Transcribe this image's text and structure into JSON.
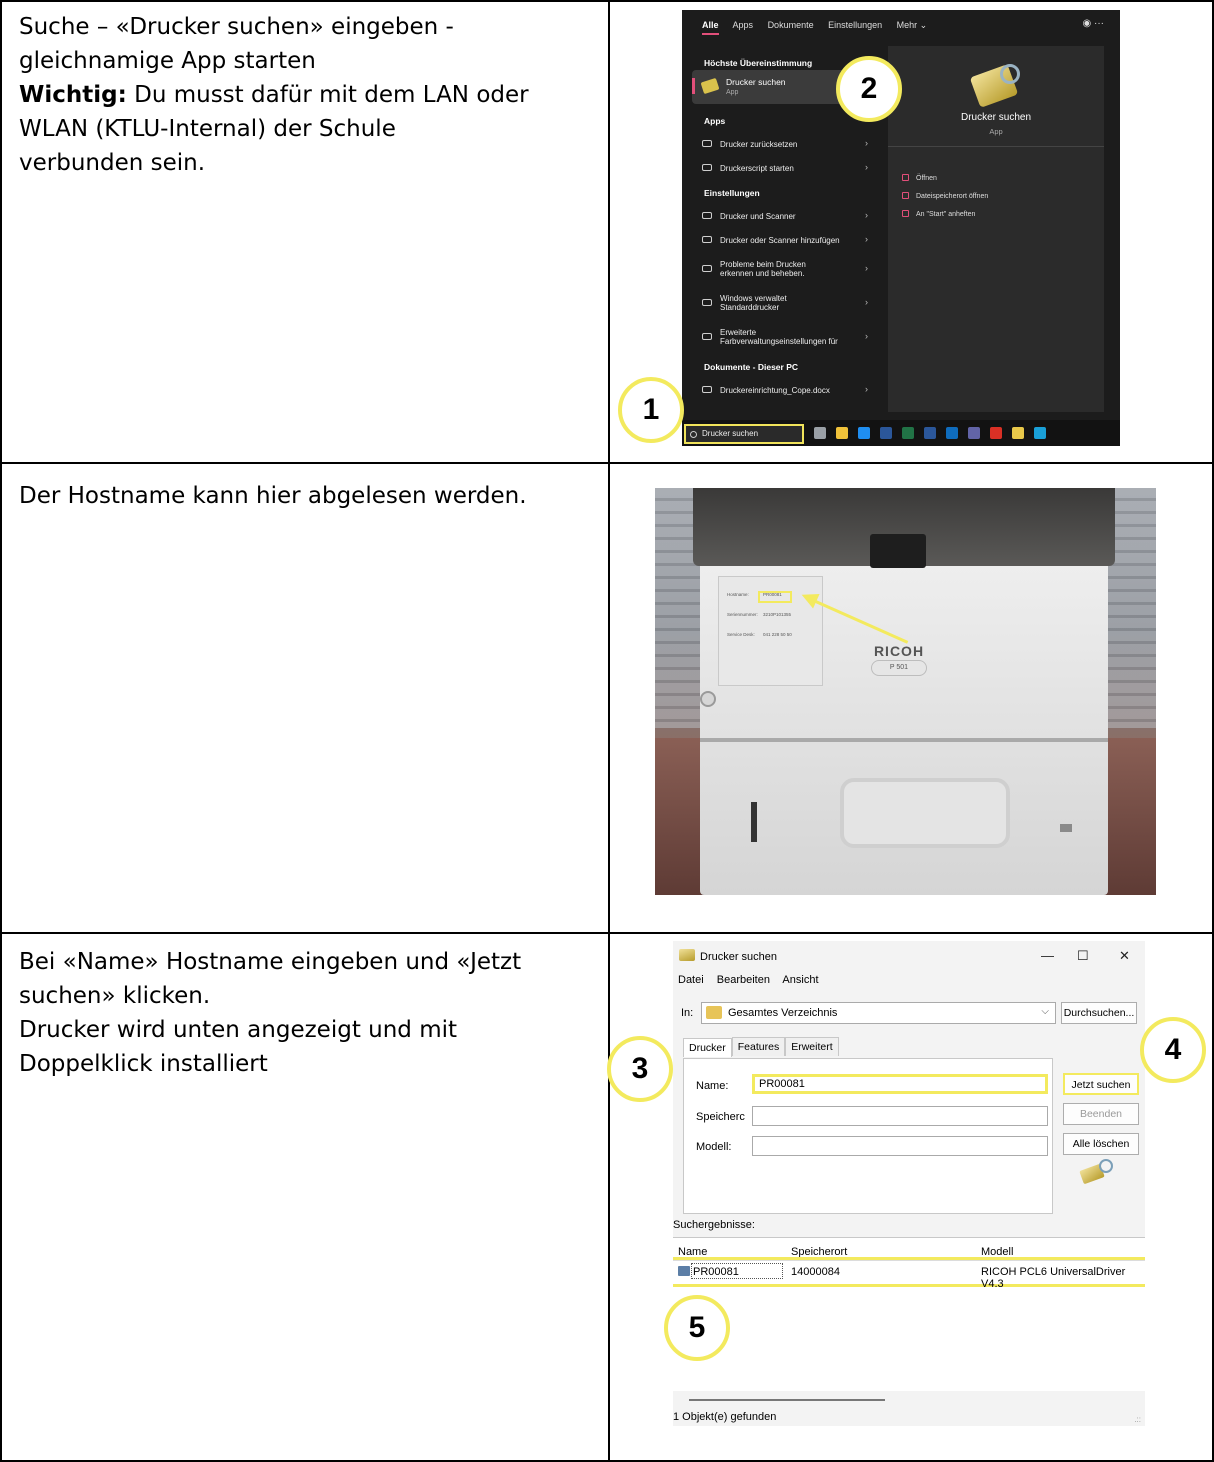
{
  "rows": [
    {
      "text_parts": {
        "line1": "Suche – «Drucker suchen» eingeben -",
        "line2": "gleichnamige App starten",
        "important_label": "Wichtig:",
        "important_rest": " Du musst dafür mit dem LAN oder",
        "line4": "WLAN (KTLU-Internal) der Schule",
        "line5": "verbunden sein."
      }
    },
    {
      "text": "Der Hostname kann hier abgelesen werden."
    },
    {
      "text_parts": {
        "line1": "Bei «Name» Hostname eingeben und «Jetzt",
        "line2": "suchen» klicken.",
        "line3": "Drucker wird unten angezeigt und mit",
        "line4": "Doppelklick installiert"
      }
    }
  ],
  "badges": [
    "1",
    "2",
    "3",
    "4",
    "5"
  ],
  "windows_search": {
    "tabs": [
      "Alle",
      "Apps",
      "Dokumente",
      "Einstellungen",
      "Mehr ⌄"
    ],
    "account_icon": "account-icon",
    "more_label": "···",
    "best_match_heading": "Höchste Übereinstimmung",
    "best_match": {
      "title": "Drucker suchen",
      "subtitle": "App"
    },
    "apps_heading": "Apps",
    "apps": [
      "Drucker zurücksetzen",
      "Druckerscript starten"
    ],
    "settings_heading": "Einstellungen",
    "settings": [
      "Drucker und Scanner",
      "Drucker oder Scanner hinzufügen",
      "Probleme beim Drucken erkennen und beheben.",
      "Windows verwaltet Standarddrucker",
      "Erweiterte Farbverwaltungseinstellungen für"
    ],
    "documents_heading": "Dokumente - Dieser PC",
    "documents": [
      "Druckereinrichtung_Cope.docx"
    ],
    "preview": {
      "title": "Drucker suchen",
      "subtitle": "App",
      "actions": [
        "Öffnen",
        "Dateispeicherort öffnen",
        "An \"Start\" anheften"
      ]
    },
    "taskbar_search": "Drucker suchen",
    "taskbar_icon_colors": [
      "#9aa0a6",
      "#f0c23a",
      "#1f8ef1",
      "#2b579a",
      "#217346",
      "#2b579a",
      "#0f6cbd",
      "#6264a7",
      "#d93025",
      "#e8c84a",
      "#1aa0d8"
    ]
  },
  "printer_photo": {
    "label_lines": [
      "Hostname:",
      "Seriennummer:",
      "Service Desk:"
    ],
    "label_values": [
      "PR00081",
      "3210P101355",
      "041 228 50 50"
    ],
    "brand": "RICOH",
    "model": "P 501"
  },
  "dialog": {
    "title": "Drucker suchen",
    "window_controls": [
      "—",
      "☐",
      "✕"
    ],
    "menu": [
      "Datei",
      "Bearbeiten",
      "Ansicht"
    ],
    "in_label": "In:",
    "scope": "Gesamtes Verzeichnis",
    "browse_button": "Durchsuchen...",
    "tabs": [
      "Drucker",
      "Features",
      "Erweitert"
    ],
    "fields": [
      {
        "label": "Name:",
        "value": "PR00081"
      },
      {
        "label": "Speicherc",
        "value": ""
      },
      {
        "label": "Modell:",
        "value": ""
      }
    ],
    "buttons": {
      "search_now": "Jetzt suchen",
      "stop": "Beenden",
      "clear_all": "Alle löschen"
    },
    "results_label": "Suchergebnisse:",
    "columns": [
      "Name",
      "Speicherort",
      "Modell"
    ],
    "results": [
      {
        "name": "PR00081",
        "location": "14000084",
        "model": "RICOH PCL6 UniversalDriver V4.3"
      }
    ],
    "status": "1 Objekt(e) gefunden",
    "grip": ".::"
  }
}
